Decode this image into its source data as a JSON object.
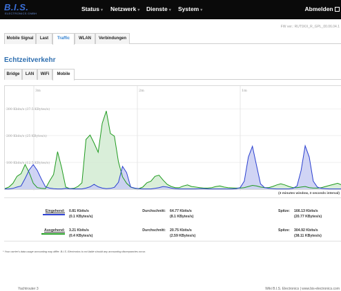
{
  "header": {
    "logo_text": "B.I.S.",
    "logo_sub": "ELECTRONICS GMBH",
    "nav": [
      {
        "label": "Status"
      },
      {
        "label": "Netzwerk"
      },
      {
        "label": "Dienste"
      },
      {
        "label": "System"
      }
    ],
    "logout": "Abmelden",
    "fw_version": "FW ver.: RUT9XX_R_GPL_00.06.04.1"
  },
  "main_tabs": [
    {
      "label": "Mobile Signal"
    },
    {
      "label": "Last"
    },
    {
      "label": "Traffic"
    },
    {
      "label": "WLAN"
    },
    {
      "label": "Verbindungen"
    }
  ],
  "active_main_tab": "Traffic",
  "page_title": "Echtzeitverkehr",
  "sub_tabs": [
    {
      "label": "Bridge"
    },
    {
      "label": "LAN"
    },
    {
      "label": "WiFi"
    },
    {
      "label": "Mobile"
    }
  ],
  "active_sub_tab": "Mobile",
  "chart_data": {
    "type": "area",
    "x_tick_labels": [
      "3m",
      "2m",
      "1m"
    ],
    "y_gridline_labels": [
      "300 Kbits/s (37.5 KBytes/s)",
      "200 Kbits/s (25 KBytes/s)",
      "100 Kbits/s (12.5 KBytes/s)"
    ],
    "y_gridline_values": [
      300,
      200,
      100
    ],
    "ylim": [
      0,
      380
    ],
    "note": "(3 minutes window, 3 seconds interval)",
    "series": [
      {
        "color": "#2a3fd0",
        "fill": "#c8cdf2",
        "values": [
          1,
          1,
          3,
          8,
          12,
          40,
          72,
          92,
          70,
          38,
          9,
          4,
          2,
          1,
          1,
          3,
          2,
          1,
          1,
          1,
          4,
          9,
          18,
          9,
          4,
          2,
          3,
          7,
          26,
          85,
          62,
          8,
          4,
          2,
          1,
          1,
          1,
          3,
          6,
          10,
          8,
          4,
          2,
          1,
          1,
          1,
          1,
          1,
          2,
          2,
          1,
          1,
          1,
          1,
          1,
          1,
          1,
          2,
          6,
          30,
          120,
          160,
          90,
          20,
          6,
          3,
          2,
          1,
          1,
          1,
          1,
          3,
          12,
          70,
          162,
          120,
          30,
          8,
          3,
          2,
          1,
          1,
          1,
          1
        ]
      },
      {
        "color": "#1e9a1e",
        "fill": "#d2ebd2",
        "values": [
          2,
          8,
          22,
          48,
          58,
          92,
          62,
          22,
          6,
          3,
          2,
          30,
          55,
          140,
          80,
          8,
          2,
          3,
          10,
          24,
          186,
          202,
          172,
          138,
          246,
          292,
          208,
          198,
          102,
          46,
          22,
          8,
          3,
          2,
          8,
          24,
          30,
          48,
          52,
          34,
          18,
          10,
          6,
          6,
          12,
          16,
          10,
          8,
          6,
          4,
          4,
          6,
          10,
          12,
          8,
          6,
          5,
          4,
          4,
          6,
          10,
          14,
          12,
          8,
          6,
          6,
          10,
          16,
          20,
          16,
          10,
          6,
          6,
          8,
          10,
          6,
          4,
          4,
          6,
          10,
          14,
          18,
          22,
          16
        ]
      }
    ]
  },
  "stats": {
    "incoming": {
      "label": "Eingehend:",
      "current_kbit": "0.81 Kbits/s",
      "current_kbyte": "(0.1 KBytes/s)",
      "avg_label": "Durchschnitt:",
      "avg_kbit": "64.77 Kbits/s",
      "avg_kbyte": "(8.1 KBytes/s)",
      "peak_label": "Spitze:",
      "peak_kbit": "166.13 Kbits/s",
      "peak_kbyte": "(20.77 KBytes/s)",
      "color": "#2a3fd0"
    },
    "outgoing": {
      "label": "Ausgehend:",
      "current_kbit": "3.21 Kbits/s",
      "current_kbyte": "(0.4 KBytes/s)",
      "avg_label": "Durchschnitt:",
      "avg_kbit": "20.75 Kbits/s",
      "avg_kbyte": "(2.59 KBytes/s)",
      "peak_label": "Spitze:",
      "peak_kbit": "304.92 Kbits/s",
      "peak_kbyte": "(38.11 KBytes/s)",
      "color": "#1e9a1e"
    }
  },
  "disclaimer": "* Your carrier's data usage accounting may differ. B.I.S. Electronics is not liable should any accounting discrepancies occur.",
  "footer": {
    "left": "Yachtrouter 3",
    "right": "Wiki B.I.S. Electronics  |  www.bis-electronics.com"
  }
}
